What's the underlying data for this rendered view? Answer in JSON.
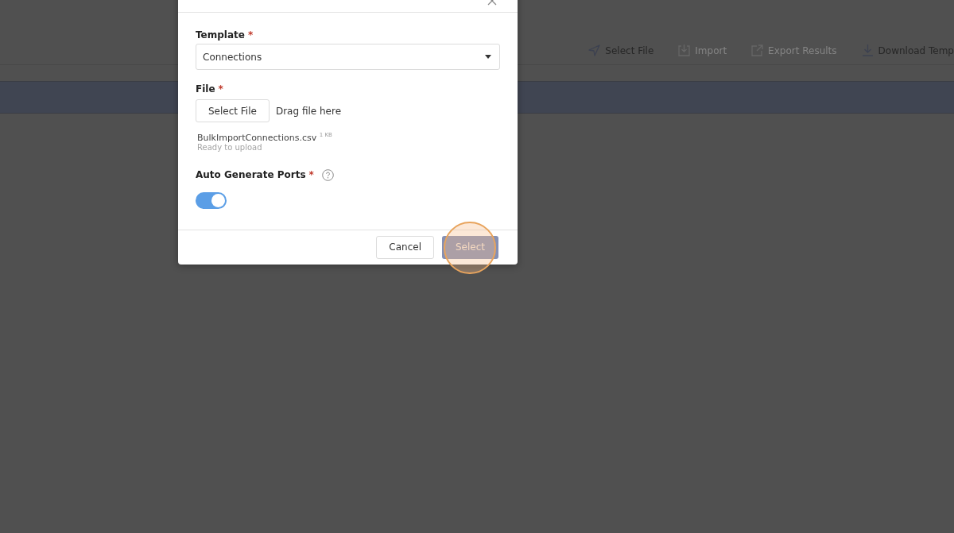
{
  "toolbar": {
    "actions": [
      {
        "label": "Select File",
        "kind": "send",
        "disabled": false
      },
      {
        "label": "Import",
        "kind": "import",
        "disabled": true
      },
      {
        "label": "Export Results",
        "kind": "export",
        "disabled": true
      },
      {
        "label": "Download Temp",
        "kind": "download",
        "disabled": false
      }
    ]
  },
  "dialog": {
    "template": {
      "label": "Template",
      "required_mark": "*",
      "value": "Connections"
    },
    "file": {
      "label": "File",
      "required_mark": "*",
      "button": "Select File",
      "hint": "Drag file here",
      "name": "BulkImportConnections.csv",
      "size": "1 KB",
      "status": "Ready to upload"
    },
    "auto_ports": {
      "label": "Auto Generate Ports",
      "required_mark": "*",
      "on": true
    },
    "buttons": [
      {
        "label": "Cancel",
        "kind": "secondary",
        "highlighted": false
      },
      {
        "label": "Select",
        "kind": "primary",
        "highlighted": true
      }
    ]
  }
}
